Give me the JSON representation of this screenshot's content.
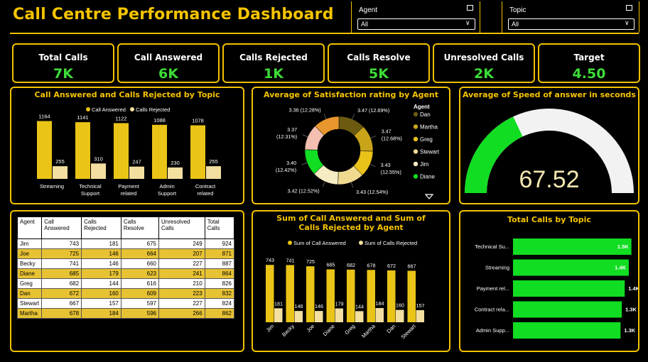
{
  "header": {
    "title": "Call Centre Performance Dashboard"
  },
  "filters": {
    "agent": {
      "label": "Agent",
      "value": "All"
    },
    "topic": {
      "label": "Topic",
      "value": "All"
    }
  },
  "kpis": [
    {
      "label": "Total Calls",
      "value": "7K"
    },
    {
      "label": "Call Answered",
      "value": "6K"
    },
    {
      "label": "Calls Rejected",
      "value": "1K"
    },
    {
      "label": "Calls Resolve",
      "value": "5K"
    },
    {
      "label": "Unresolved Calls",
      "value": "2K"
    },
    {
      "label": "Target",
      "value": "4.50"
    }
  ],
  "colors": {
    "accent": "#f2c200",
    "kpi_value": "#3ddc38",
    "bar_primary": "#eac417",
    "bar_secondary": "#f3dfa0",
    "gauge_fill": "#11dd22",
    "gauge_bg": "#f2f2f2"
  },
  "chart_data": [
    {
      "id": "topic_chart",
      "type": "bar",
      "title": "Call Answered and Calls Rejected by Topic",
      "legend_position": "top",
      "categories": [
        "Streaming",
        "Technical Support",
        "Payment related",
        "Admin Support",
        "Contract related"
      ],
      "series": [
        {
          "name": "Call Answered",
          "values": [
            1164,
            1141,
            1122,
            1088,
            1078
          ]
        },
        {
          "name": "Calls Rejected",
          "values": [
            255,
            310,
            247,
            230,
            255
          ]
        }
      ]
    },
    {
      "id": "satisfaction_chart",
      "type": "pie",
      "title": "Average of Satisfaction rating by Agent",
      "legend_title": "Agent",
      "slices": [
        {
          "name": "Dan",
          "value": 3.47,
          "label": "3.47 (12.69%)",
          "color": "#6b5a10"
        },
        {
          "name": "Martha",
          "value": 3.47,
          "label": "3.47 (12.68%)",
          "color": "#c9a41a"
        },
        {
          "name": "Greg",
          "value": 3.43,
          "label": "3.43 (12.55%)",
          "color": "#e9c21a"
        },
        {
          "name": "Stewart",
          "value": 3.43,
          "label": "3.43 (12.54%)",
          "color": "#f0da90"
        },
        {
          "name": "Jim",
          "value": 3.42,
          "label": "3.42 (12.52%)",
          "color": "#f6ecc4"
        },
        {
          "name": "Diane",
          "value": 3.4,
          "label": "3.40 (12.42%)",
          "color": "#11dd22"
        },
        {
          "name": "Becky",
          "value": 3.37,
          "label": "3.37 (12.31%)",
          "color": "#f2bfb0"
        },
        {
          "name": "Joe",
          "value": 3.36,
          "label": "3.36 (12.28%)",
          "color": "#e8962e"
        }
      ],
      "legend_items": [
        "Dan",
        "Martha",
        "Greg",
        "Stewart",
        "Jim",
        "Diane"
      ]
    },
    {
      "id": "speed_gauge",
      "type": "gauge",
      "title": "Average of Speed of answer in seconds",
      "value": 67.52,
      "value_label": "67.52",
      "fill_fraction": 0.36
    },
    {
      "id": "agent_chart",
      "type": "bar",
      "title": "Sum of Call Answered and Sum of Calls Rejected by Agent",
      "legend_position": "top",
      "categories": [
        "Jim",
        "Becky",
        "Joe",
        "Diane",
        "Greg",
        "Martha",
        "Dan",
        "Stewart"
      ],
      "series": [
        {
          "name": "Sum of Call Answered",
          "values": [
            743,
            741,
            725,
            685,
            682,
            678,
            672,
            667
          ]
        },
        {
          "name": "Sum of Calls Rejected",
          "values": [
            181,
            146,
            146,
            179,
            144,
            184,
            160,
            157
          ]
        }
      ]
    },
    {
      "id": "total_topic_chart",
      "type": "bar",
      "orientation": "horizontal",
      "title": "Total Calls by Topic",
      "categories": [
        "Technical Su...",
        "Streaming",
        "Payment rel...",
        "Contract rela...",
        "Admin Supp..."
      ],
      "values": [
        1451,
        1419,
        1369,
        1333,
        1318
      ],
      "value_labels": [
        "1.5K",
        "1.4K",
        "1.4K",
        "1.3K",
        "1.3K"
      ]
    }
  ],
  "agent_table": {
    "columns": [
      "Agent",
      "Call Answered",
      "Calls Rejected",
      "Calls Resolve",
      "Unresolved Calls",
      "Total Calls"
    ],
    "rows": [
      [
        "Jim",
        "743",
        "181",
        "675",
        "249",
        "924"
      ],
      [
        "Joe",
        "725",
        "146",
        "664",
        "207",
        "871"
      ],
      [
        "Becky",
        "741",
        "146",
        "660",
        "227",
        "887"
      ],
      [
        "Diane",
        "685",
        "179",
        "623",
        "241",
        "864"
      ],
      [
        "Greg",
        "682",
        "144",
        "616",
        "210",
        "826"
      ],
      [
        "Dan",
        "672",
        "160",
        "609",
        "223",
        "832"
      ],
      [
        "Stewart",
        "667",
        "157",
        "597",
        "227",
        "824"
      ],
      [
        "Martha",
        "678",
        "184",
        "596",
        "266",
        "862"
      ]
    ]
  }
}
